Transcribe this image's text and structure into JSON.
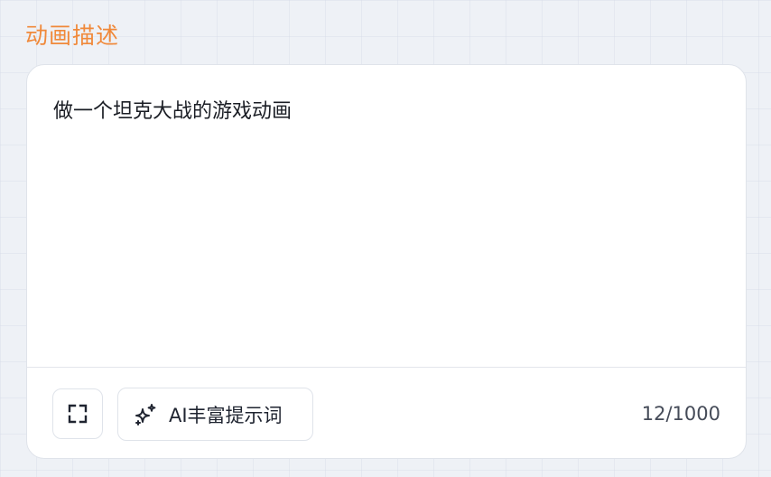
{
  "section": {
    "title": "动画描述"
  },
  "prompt": {
    "value": "做一个坦克大战的游戏动画"
  },
  "footer": {
    "expand_icon": "expand-icon",
    "ai_button": {
      "icon": "sparkles-icon",
      "label": "AI丰富提示词"
    },
    "char_count": "12/1000"
  },
  "colors": {
    "accent": "#f0893a",
    "text": "#1a1d24",
    "muted": "#454b58",
    "border": "#dfe3ea",
    "background": "#eef1f6"
  }
}
